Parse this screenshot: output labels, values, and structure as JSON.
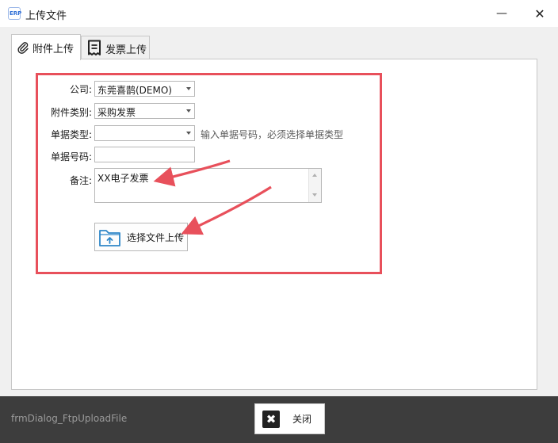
{
  "window": {
    "title": "上传文件",
    "app_icon_text": "ERP",
    "minimize_glyph": "—",
    "close_glyph": "✕"
  },
  "tabs": [
    {
      "label": "附件上传",
      "icon": "paperclip-icon",
      "active": true
    },
    {
      "label": "发票上传",
      "icon": "receipt-icon",
      "active": false
    }
  ],
  "form": {
    "company_label": "公司:",
    "company_value": "东莞喜鹊(DEMO)",
    "attachment_type_label": "附件类别:",
    "attachment_type_value": "采购发票",
    "doc_type_label": "单据类型:",
    "doc_type_value": "",
    "doc_type_hint": "输入单据号码，必须选择单据类型",
    "doc_number_label": "单据号码:",
    "doc_number_value": "",
    "remark_label": "备注:",
    "remark_value": "XX电子发票",
    "upload_button_label": "选择文件上传"
  },
  "footer": {
    "form_name": "frmDialog_FtpUploadFile",
    "close_button_label": "关闭",
    "close_icon_glyph": "✖"
  },
  "colors": {
    "highlight": "#e8505b",
    "footer_bg": "#3d3d3d",
    "upload_icon": "#2e86c8"
  }
}
